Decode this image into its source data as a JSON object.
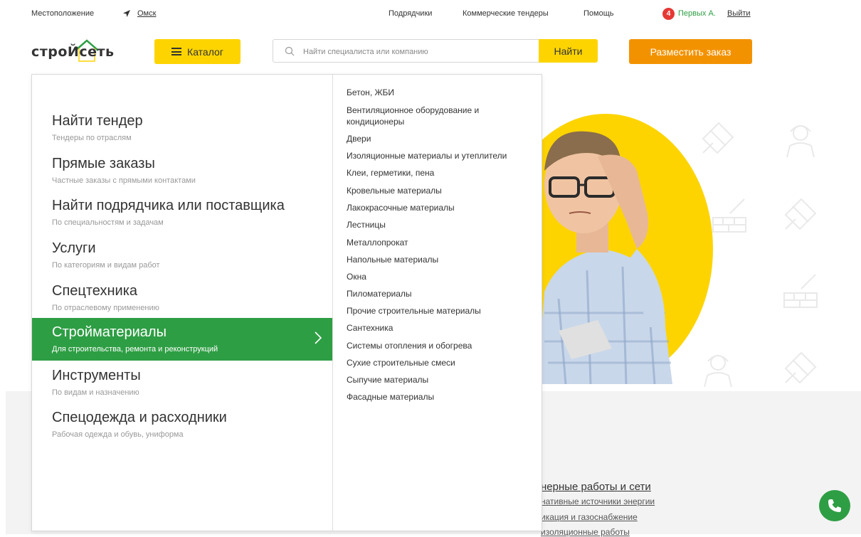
{
  "topbar": {
    "location_label": "Местоположение",
    "city": "Омск",
    "nav": [
      "Подрядчики",
      "Коммерческие тендеры",
      "Помощь"
    ],
    "notifications_count": "4",
    "user_name": "Первых А.",
    "logout": "Выйти"
  },
  "header": {
    "logo_text": "строЙсеть",
    "catalog_label": "Каталог",
    "search_placeholder": "Найти специалиста или компанию",
    "search_button": "Найти",
    "order_button": "Разместить заказ"
  },
  "menu": {
    "items": [
      {
        "title": "Найти тендер",
        "subtitle": "Тендеры по отраслям"
      },
      {
        "title": "Прямые заказы",
        "subtitle": "Частные заказы с прямыми контактами"
      },
      {
        "title": "Найти подрядчика или поставщика",
        "subtitle": "По специальностям и задачам"
      },
      {
        "title": "Услуги",
        "subtitle": "По категориям и видам работ"
      },
      {
        "title": "Спецтехника",
        "subtitle": "По отраслевому применению"
      },
      {
        "title": "Стройматериалы",
        "subtitle": "Для строительства, ремонта и реконструкций"
      },
      {
        "title": "Инструменты",
        "subtitle": "По видам и назначению"
      },
      {
        "title": "Спецодежда и расходники",
        "subtitle": "Рабочая одежда и обувь, униформа"
      }
    ],
    "active_index": 5,
    "subitems": [
      "Бетон, ЖБИ",
      "Вентиляционное оборудование и кондиционеры",
      "Двери",
      "Изоляционные материалы и утеплители",
      "Клеи, герметики, пена",
      "Кровельные материалы",
      "Лакокрасочные материалы",
      "Лестницы",
      "Металлопрокат",
      "Напольные материалы",
      "Окна",
      "Пиломатериалы",
      "Прочие строительные материалы",
      "Сантехника",
      "Системы отопления и обогрева",
      "Сухие строительные смеси",
      "Сыпучие материалы",
      "Фасадные материалы"
    ]
  },
  "background": {
    "links": [
      "нерные работы и сети",
      "нативные источники энергии",
      "икация и газоснабжение",
      "изоляционные работы"
    ]
  },
  "colors": {
    "yellow": "#fdd400",
    "orange": "#f39200",
    "green": "#2e9e44",
    "badge": "#e53935"
  }
}
